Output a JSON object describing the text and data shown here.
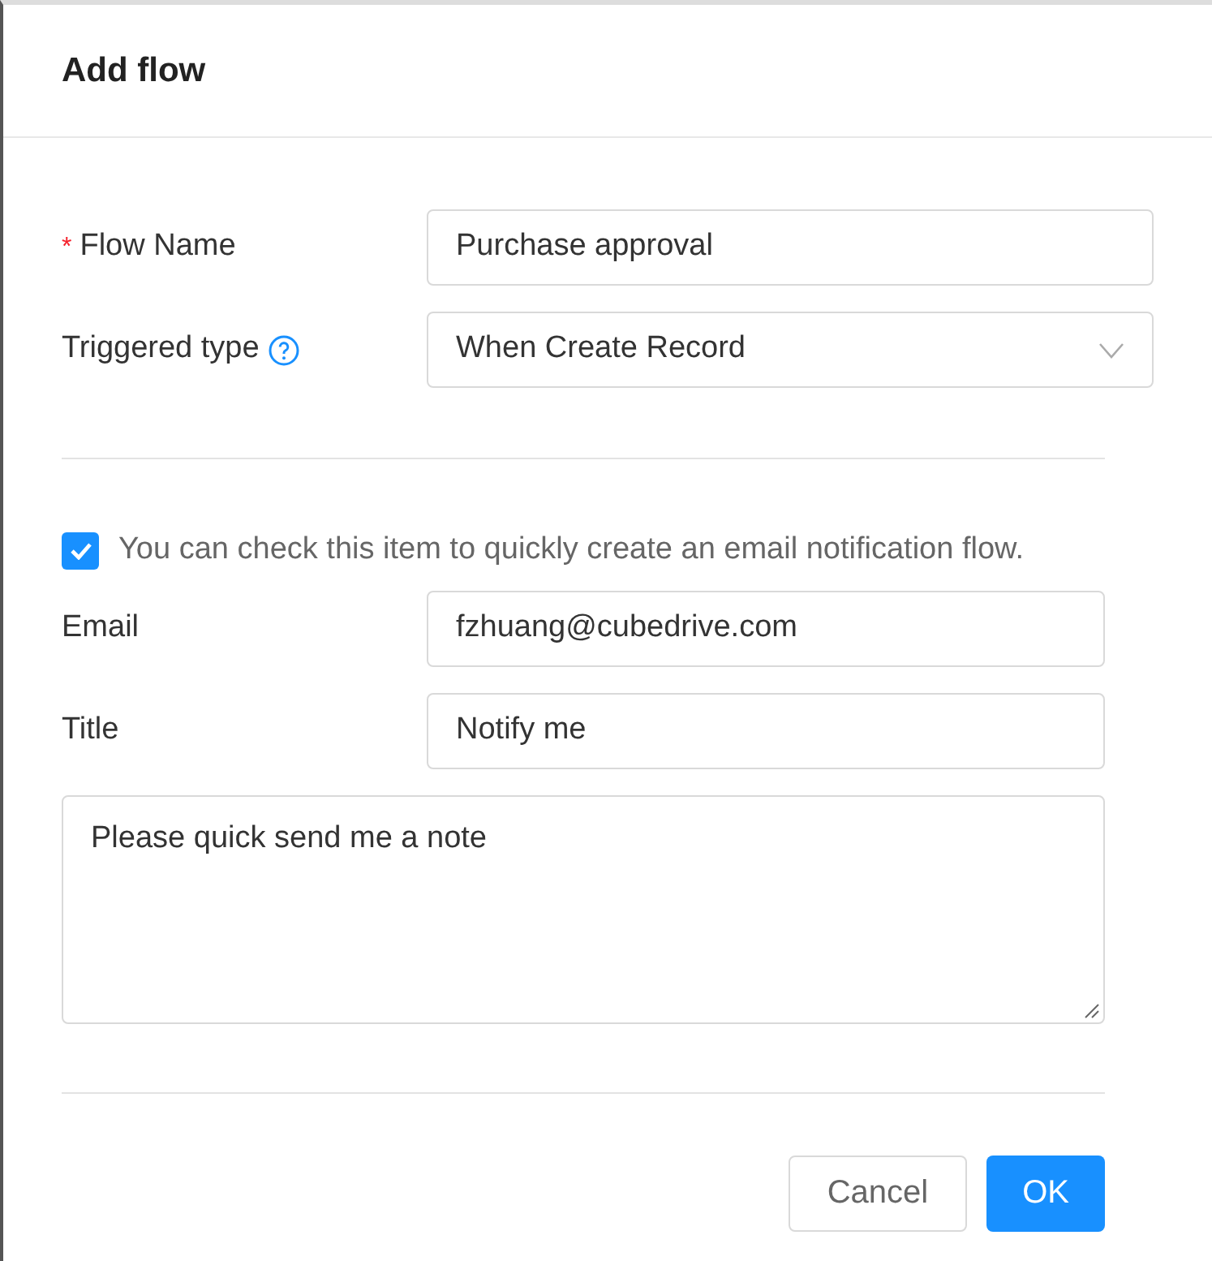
{
  "dialog": {
    "title": "Add flow"
  },
  "fields": [
    {
      "required_mark": "*",
      "label": "Flow Name",
      "kind": "input",
      "value": "Purchase approval"
    },
    {
      "label": "Triggered type",
      "help": true,
      "kind": "select",
      "value": "When Create Record"
    }
  ],
  "email_option": {
    "checked": true,
    "label": "You can check this item to quickly create an email notification flow."
  },
  "email_fields": [
    {
      "label": "Email",
      "kind": "input",
      "value": "fzhuang@cubedrive.com"
    },
    {
      "label": "Title",
      "kind": "input",
      "value": "Notify me"
    },
    {
      "kind": "textarea",
      "value": "Please quick send me a note"
    }
  ],
  "buttons": [
    {
      "label": "Cancel",
      "kind": "default"
    },
    {
      "label": "OK",
      "kind": "primary"
    }
  ]
}
